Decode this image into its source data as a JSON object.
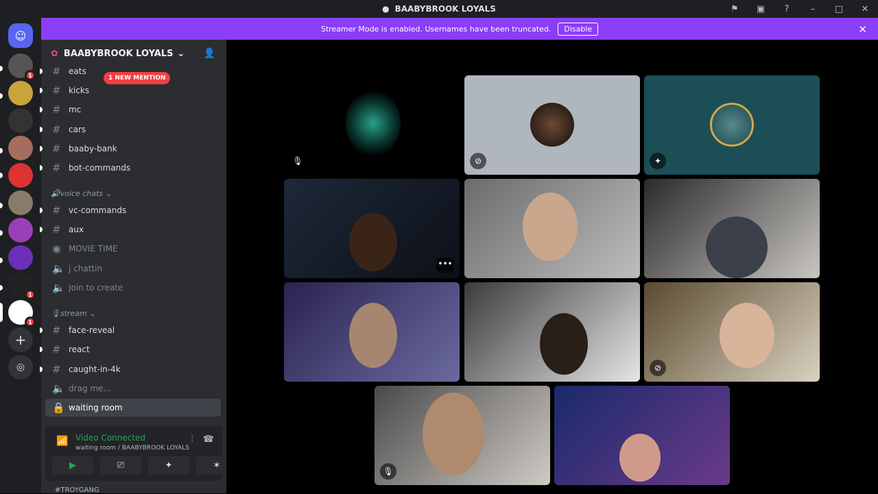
{
  "window": {
    "title": "BAABYBROOK LOYALS"
  },
  "banner": {
    "text": "Streamer Mode is enabled. Usernames have been truncated.",
    "button": "Disable"
  },
  "server": {
    "name": "BAABYBROOK LOYALS"
  },
  "mention_pill": "1 NEW MENTION",
  "categories": {
    "voice": "voice chats",
    "stream": "stream"
  },
  "channels": [
    {
      "label": "eats"
    },
    {
      "label": "kicks"
    },
    {
      "label": "mc"
    },
    {
      "label": "cars"
    },
    {
      "label": "baaby-bank"
    },
    {
      "label": "bot-commands"
    },
    {
      "label": "vc-commands"
    },
    {
      "label": "aux"
    },
    {
      "label": "MOVIE TIME"
    },
    {
      "label": "j chattin"
    },
    {
      "label": "join to create"
    },
    {
      "label": "face-reveal"
    },
    {
      "label": "react"
    },
    {
      "label": "caught-in-4k"
    },
    {
      "label": "drag me..."
    },
    {
      "label": "waiting room"
    }
  ],
  "guild_badges": [
    "1",
    "1",
    "1"
  ],
  "voice_panel": {
    "status": "Video Connected",
    "location": "waiting room / BAABYBROOK LOYALS"
  },
  "bottom_user": "#TROYGANG",
  "colors": {
    "brand": "#5865f2",
    "banner": "#8b3ef7",
    "connected": "#23a55a",
    "alert": "#f23f42"
  }
}
